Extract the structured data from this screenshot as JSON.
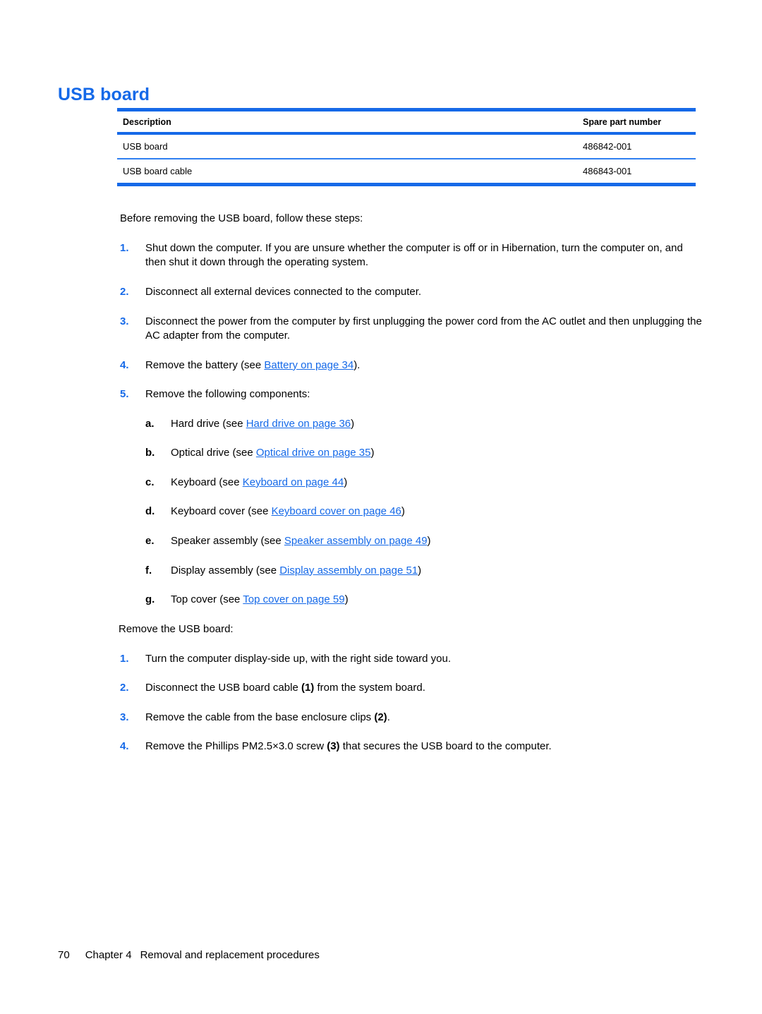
{
  "document": {
    "section_title": "USB board",
    "accent_color": "#1569e8",
    "link_color": "#1569e8",
    "text_color": "#000000"
  },
  "parts_table": {
    "headers": [
      "Description",
      "Spare part number"
    ],
    "rows": [
      {
        "description": "USB board",
        "spare_part_number": "486842-001"
      },
      {
        "description": "USB board cable",
        "spare_part_number": "486843-001"
      }
    ]
  },
  "before_section": {
    "lead": "Before removing the USB board, follow these steps:",
    "steps": [
      {
        "marker": "1.",
        "text": "Shut down the computer. If you are unsure whether the computer is off or in Hibernation, turn the computer on, and then shut it down through the operating system."
      },
      {
        "marker": "2.",
        "text": "Disconnect all external devices connected to the computer."
      },
      {
        "marker": "3.",
        "text": "Disconnect the power from the computer by first unplugging the power cord from the AC outlet and then unplugging the AC adapter from the computer."
      },
      {
        "marker": "4.",
        "prefix": "Remove the battery (see ",
        "link": "Battery on page 34",
        "suffix": ")."
      },
      {
        "marker": "5.",
        "text": "Remove the following components:"
      }
    ],
    "substeps": [
      {
        "marker": "a.",
        "prefix": "Hard drive (see ",
        "link": "Hard drive on page 36",
        "suffix": ")"
      },
      {
        "marker": "b.",
        "prefix": "Optical drive (see ",
        "link": "Optical drive on page 35",
        "suffix": ")"
      },
      {
        "marker": "c.",
        "prefix": "Keyboard (see ",
        "link": "Keyboard on page 44",
        "suffix": ")"
      },
      {
        "marker": "d.",
        "prefix": "Keyboard cover (see ",
        "link": "Keyboard cover on page 46",
        "suffix": ")"
      },
      {
        "marker": "e.",
        "prefix": "Speaker assembly (see ",
        "link": "Speaker assembly on page 49",
        "suffix": ")"
      },
      {
        "marker": "f.",
        "prefix": "Display assembly (see ",
        "link": "Display assembly on page 51",
        "suffix": ")"
      },
      {
        "marker": "g.",
        "prefix": "Top cover (see ",
        "link": "Top cover on page 59",
        "suffix": ")"
      }
    ]
  },
  "remove_section": {
    "lead": "Remove the USB board:",
    "steps": [
      {
        "marker": "1.",
        "text": "Turn the computer display-side up, with the right side toward you."
      },
      {
        "marker": "2.",
        "prefix": "Disconnect the USB board cable ",
        "callout": "(1)",
        "suffix": " from the system board."
      },
      {
        "marker": "3.",
        "prefix": "Remove the cable from the base enclosure clips ",
        "callout": "(2)",
        "suffix": "."
      },
      {
        "marker": "4.",
        "prefix": "Remove the Phillips PM2.5×3.0 screw ",
        "callout": "(3)",
        "suffix": " that secures the USB board to the computer."
      }
    ]
  },
  "footer": {
    "page_number": "70",
    "chapter": "Chapter 4",
    "chapter_title": "Removal and replacement procedures"
  }
}
